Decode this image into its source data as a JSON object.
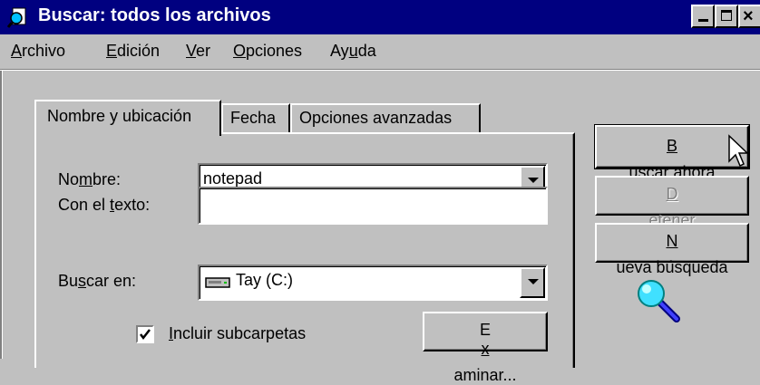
{
  "window": {
    "title": "Buscar: todos los archivos",
    "icon": "search-document-icon",
    "accent_color": "#000080",
    "face_color": "#c0c0c0"
  },
  "menu": {
    "items": [
      {
        "label_pre": "",
        "label_ul": "A",
        "label_post": "rchivo"
      },
      {
        "label_pre": "",
        "label_ul": "E",
        "label_post": "dición"
      },
      {
        "label_pre": "",
        "label_ul": "V",
        "label_post": "er"
      },
      {
        "label_pre": "",
        "label_ul": "O",
        "label_post": "pciones"
      },
      {
        "label_pre": "Ay",
        "label_ul": "u",
        "label_post": "da"
      }
    ]
  },
  "tabs": [
    {
      "label": "Nombre y ubicación",
      "active": true
    },
    {
      "label": "Fecha",
      "active": false
    },
    {
      "label": "Opciones avanzadas",
      "active": false
    }
  ],
  "form": {
    "name_label_pre": "No",
    "name_label_ul": "m",
    "name_label_post": "bre:",
    "name_value": "notepad",
    "text_label_pre": "Con el ",
    "text_label_ul": "t",
    "text_label_post": "exto:",
    "text_value": "",
    "lookin_label_pre": "Bu",
    "lookin_label_ul": "s",
    "lookin_label_post": "car en:",
    "lookin_value": "Tay (C:)",
    "lookin_icon": "drive-icon",
    "subfolders_label_pre": "",
    "subfolders_label_ul": "I",
    "subfolders_label_post": "ncluir subcarpetas",
    "subfolders_checked": true,
    "browse_pre": "E",
    "browse_ul": "x",
    "browse_post": "aminar..."
  },
  "actions": {
    "find_pre": "",
    "find_ul": "B",
    "find_post": "uscar ahora",
    "stop_pre": "",
    "stop_ul": "D",
    "stop_post": "etener",
    "new_pre": "",
    "new_ul": "N",
    "new_post": "ueva búsqueda",
    "decoration_icon": "magnifier-icon"
  }
}
